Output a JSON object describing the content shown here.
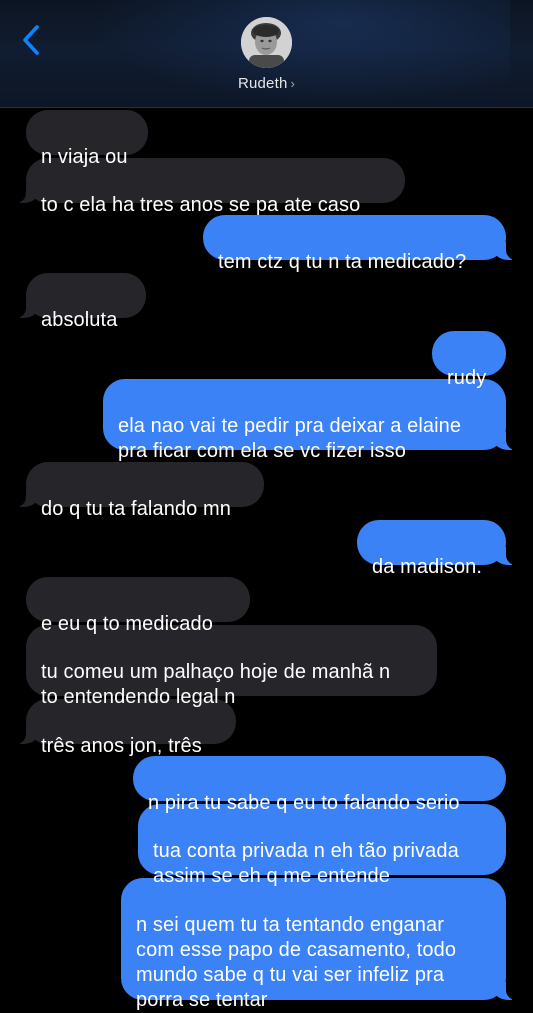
{
  "header": {
    "contact_name": "Rudeth",
    "chevron": "›",
    "back_icon": "chevron-left-icon",
    "accent": "#0a84ff"
  },
  "colors": {
    "incoming_bubble": "#26252a",
    "outgoing_bubble": "#3b82f6",
    "background": "#000000"
  },
  "messages": [
    {
      "direction": "incoming",
      "text": "n viaja ou"
    },
    {
      "direction": "incoming",
      "text": "to c ela ha tres anos se pa ate caso"
    },
    {
      "direction": "outgoing",
      "text": "tem ctz q tu n ta medicado?"
    },
    {
      "direction": "incoming",
      "text": "absoluta"
    },
    {
      "direction": "outgoing",
      "text": "rudy"
    },
    {
      "direction": "outgoing",
      "text": "ela nao vai te pedir pra deixar a elaine\npra ficar com ela se vc fizer isso"
    },
    {
      "direction": "incoming",
      "text": "do q tu ta falando mn"
    },
    {
      "direction": "outgoing",
      "text": "da madison."
    },
    {
      "direction": "incoming",
      "text": "e eu q to medicado"
    },
    {
      "direction": "incoming",
      "text": "tu comeu um palhaço hoje de manhã n\nto entendendo legal n"
    },
    {
      "direction": "incoming",
      "text": "três anos jon, três"
    },
    {
      "direction": "outgoing",
      "text": "n pira tu sabe q eu to falando serio"
    },
    {
      "direction": "outgoing",
      "text": "tua conta privada n eh tão privada\nassim se eh q me entende"
    },
    {
      "direction": "outgoing",
      "text": "n sei quem tu ta tentando enganar\ncom esse papo de casamento, todo\nmundo sabe q tu vai ser infeliz pra\nporra se tentar"
    }
  ]
}
